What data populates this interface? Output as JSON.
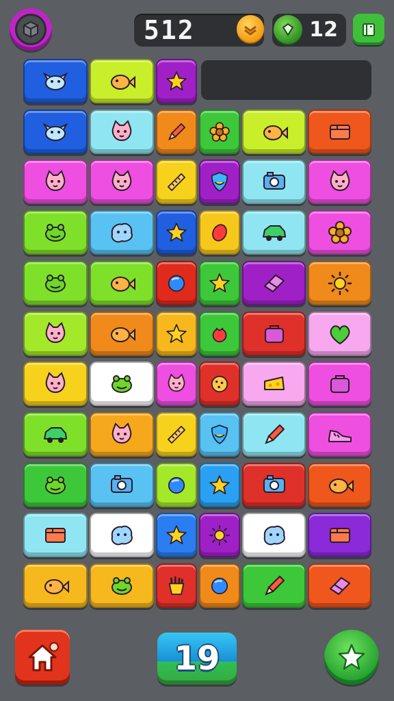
{
  "header": {
    "score": "512",
    "gems": "12",
    "menu_icon": "cube-icon",
    "coin_icon": "coin-icon",
    "gem_icon": "gem-icon",
    "book_icon": "book-icon"
  },
  "footer": {
    "level": "19",
    "home_icon": "home-icon",
    "star_icon": "star-icon"
  },
  "colors": {
    "background": "#5b5e62",
    "accent_pink": "#c024c8",
    "accent_green": "#3fbf3a",
    "accent_red": "#e2341c",
    "accent_blue": "#1a8fd9"
  },
  "board": {
    "rows": [
      [
        {
          "icon": "bird",
          "color": "#1f5fe0"
        },
        {
          "icon": "fish",
          "color": "#c9ee2a"
        },
        {
          "icon": "star",
          "color": "#a020c8"
        }
      ],
      [
        {
          "icon": "bird",
          "color": "#1f5fe0"
        },
        {
          "icon": "cat",
          "color": "#8fe6f2"
        },
        {
          "icon": "pencil",
          "color": "#f08a1a"
        },
        {
          "icon": "flower",
          "color": "#3dc83a"
        },
        {
          "icon": "fish",
          "color": "#c9ee2a"
        },
        {
          "icon": "box",
          "color": "#f0571c"
        }
      ],
      [
        {
          "icon": "cat",
          "color": "#ee4fe0"
        },
        {
          "icon": "cat",
          "color": "#ee4fe0"
        },
        {
          "icon": "ruler",
          "color": "#f6d21c"
        },
        {
          "icon": "shield",
          "color": "#a020c8"
        },
        {
          "icon": "camera",
          "color": "#8fe6f2"
        },
        {
          "icon": "cat",
          "color": "#ee4fe0"
        }
      ],
      [
        {
          "icon": "frog",
          "color": "#7fe02a"
        },
        {
          "icon": "blob",
          "color": "#58c2f2"
        },
        {
          "icon": "star",
          "color": "#1f5fe0"
        },
        {
          "icon": "egg",
          "color": "#f6c81c"
        },
        {
          "icon": "car",
          "color": "#8fe6f2"
        },
        {
          "icon": "flower",
          "color": "#ee4fe0"
        }
      ],
      [
        {
          "icon": "frog",
          "color": "#7fe02a"
        },
        {
          "icon": "fish",
          "color": "#7fe02a"
        },
        {
          "icon": "ball",
          "color": "#e02a1c"
        },
        {
          "icon": "star",
          "color": "#3dc83a"
        },
        {
          "icon": "eraser",
          "color": "#a020c8"
        },
        {
          "icon": "sun",
          "color": "#f08a1a"
        }
      ],
      [
        {
          "icon": "cat",
          "color": "#a4e82a"
        },
        {
          "icon": "fish",
          "color": "#f08a1a"
        },
        {
          "icon": "star",
          "color": "#f6b81c"
        },
        {
          "icon": "berry",
          "color": "#3dc83a"
        },
        {
          "icon": "bag",
          "color": "#e0302a"
        },
        {
          "icon": "heart",
          "color": "#f7a8ee"
        }
      ],
      [
        {
          "icon": "cat",
          "color": "#f6d21c"
        },
        {
          "icon": "frog",
          "color": "#ffffff"
        },
        {
          "icon": "cat",
          "color": "#ee4fe0"
        },
        {
          "icon": "cookie",
          "color": "#e0302a"
        },
        {
          "icon": "cheese",
          "color": "#f7a8ee"
        },
        {
          "icon": "bag",
          "color": "#ee4fe0"
        }
      ],
      [
        {
          "icon": "car",
          "color": "#7fe02a"
        },
        {
          "icon": "cat",
          "color": "#f6a81c"
        },
        {
          "icon": "ruler",
          "color": "#f6d21c"
        },
        {
          "icon": "shield",
          "color": "#58c2f2"
        },
        {
          "icon": "pencil",
          "color": "#8fe6f2"
        },
        {
          "icon": "shoe",
          "color": "#ee4fe0"
        }
      ],
      [
        {
          "icon": "frog",
          "color": "#3dc83a"
        },
        {
          "icon": "camera",
          "color": "#58c2f2"
        },
        {
          "icon": "ball",
          "color": "#a4e82a"
        },
        {
          "icon": "star",
          "color": "#2aa0f2"
        },
        {
          "icon": "camera",
          "color": "#e0302a"
        },
        {
          "icon": "fish",
          "color": "#f0571c"
        }
      ],
      [
        {
          "icon": "box",
          "color": "#8fe6f2"
        },
        {
          "icon": "blob",
          "color": "#ffffff"
        },
        {
          "icon": "star",
          "color": "#2a7ef2"
        },
        {
          "icon": "sun",
          "color": "#a020c8"
        },
        {
          "icon": "blob",
          "color": "#ffffff"
        },
        {
          "icon": "box",
          "color": "#8a2ad8"
        }
      ],
      [
        {
          "icon": "fish",
          "color": "#f6b81c"
        },
        {
          "icon": "frog",
          "color": "#f6b81c"
        },
        {
          "icon": "fries",
          "color": "#e0302a"
        },
        {
          "icon": "ball",
          "color": "#f08a1a"
        },
        {
          "icon": "pencil",
          "color": "#3dc83a"
        },
        {
          "icon": "eraser",
          "color": "#f0571c"
        }
      ]
    ]
  }
}
